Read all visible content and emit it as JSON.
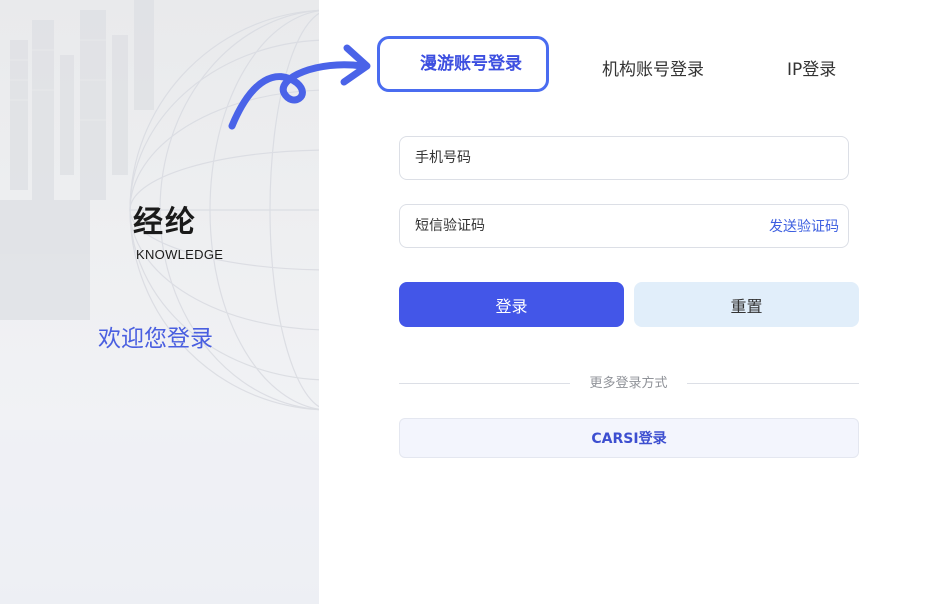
{
  "branding": {
    "logo_cn": "经纶",
    "logo_en": "KNOWLEDGE",
    "welcome": "欢迎您登录"
  },
  "tabs": [
    {
      "label": "漫游账号登录",
      "active": true
    },
    {
      "label": "机构账号登录",
      "active": false
    },
    {
      "label": "IP登录",
      "active": false
    }
  ],
  "form": {
    "phone_placeholder": "手机号码",
    "code_placeholder": "短信验证码",
    "send_code_label": "发送验证码"
  },
  "buttons": {
    "login_label": "登录",
    "reset_label": "重置"
  },
  "alt_login": {
    "divider_text": "更多登录方式",
    "carsi_label": "CARSI登录"
  },
  "colors": {
    "accent": "#4356e8",
    "reset_bg": "#e1eefa",
    "link": "#3d5fe0",
    "highlight_border": "#4a6cf0"
  }
}
